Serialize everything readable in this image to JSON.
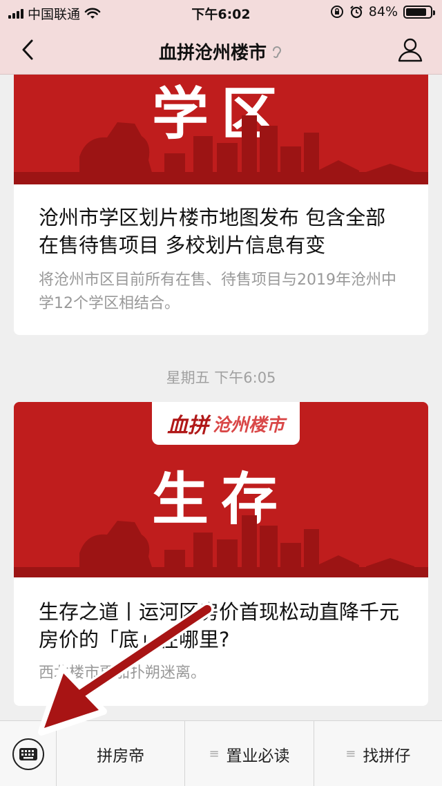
{
  "status_bar": {
    "carrier": "中国联通",
    "time": "下午6:02",
    "battery": "84%",
    "battery_level": 0.84
  },
  "nav": {
    "title": "血拼沧州楼市"
  },
  "feed": {
    "cards": [
      {
        "banner_text": "学区",
        "headline": "沧州市学区划片楼市地图发布 包含全部在售待售项目 多校划片信息有变",
        "description": "将沧州市区目前所有在售、待售项目与2019年沧州中学12个学区相结合。"
      },
      {
        "logo_main": "血拼",
        "logo_sub": "沧州楼市",
        "banner_text": "生存",
        "headline": "生存之道丨运河区房价首现松动直降千元 房价的「底」在哪里?",
        "description": "西北楼市更加扑朔迷离。"
      }
    ],
    "timestamp": "星期五 下午6:05"
  },
  "menu": {
    "items": [
      "拼房帝",
      "置业必读",
      "找拼仔"
    ]
  },
  "icons": {
    "back": "chevron-left-icon",
    "profile": "person-icon",
    "keyboard": "keyboard-icon",
    "wifi": "wifi-icon",
    "alarm": "alarm-icon",
    "lock": "rotation-lock-icon",
    "ear": "ear-icon"
  },
  "colors": {
    "banner_red": "#bf1d1d",
    "nav_bg": "#f3dcdc",
    "arrow": "#a81414"
  }
}
